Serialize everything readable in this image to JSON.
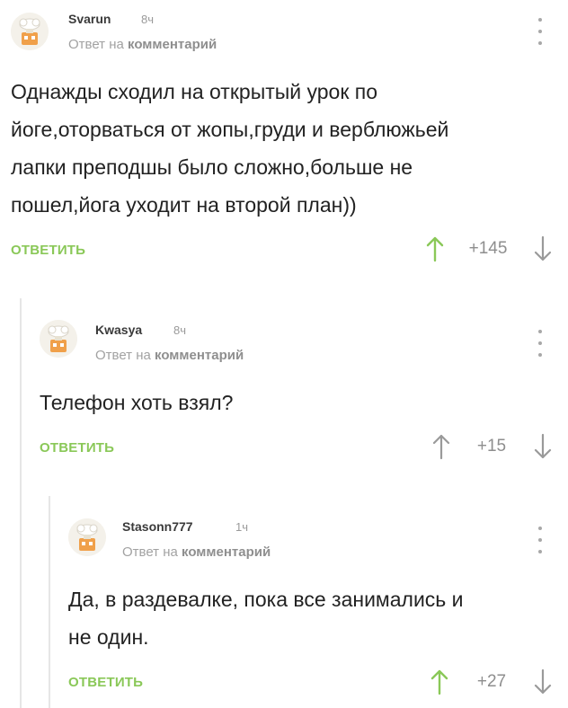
{
  "comments": [
    {
      "author": "Svarun",
      "time": "8ч",
      "reply_prefix": "Ответ на",
      "reply_link": "комментарий",
      "lines": [
        "Однажды сходил на открытый урок по",
        "йоге,оторваться от жопы,груди и верблюжьей",
        "лапки преподшы было сложно,больше не",
        "пошел,йога уходит на второй план))"
      ],
      "reply_label": "ОТВЕТИТЬ",
      "score": "+145",
      "upvoted": true
    },
    {
      "author": "Kwasya",
      "time": "8ч",
      "reply_prefix": "Ответ на",
      "reply_link": "комментарий",
      "lines": [
        "Телефон хоть взял?"
      ],
      "reply_label": "ОТВЕТИТЬ",
      "score": "+15",
      "upvoted": false
    },
    {
      "author": "Stasonn777",
      "time": "1ч",
      "reply_prefix": "Ответ на",
      "reply_link": "комментарий",
      "lines": [
        "Да, в раздевалке, пока все занимались и",
        "не один."
      ],
      "reply_label": "ОТВЕТИТЬ",
      "score": "+27",
      "upvoted": true
    }
  ],
  "colors": {
    "accent_green": "#8ac858",
    "upvote_active": "#8ac858",
    "vote_inactive": "#9a9a9a",
    "thread_line": "#e6e6e6"
  },
  "icons": {
    "avatar": "chef-avatar-icon",
    "menu": "kebab-menu-icon",
    "upvote": "arrow-up-icon",
    "downvote": "arrow-down-icon"
  }
}
